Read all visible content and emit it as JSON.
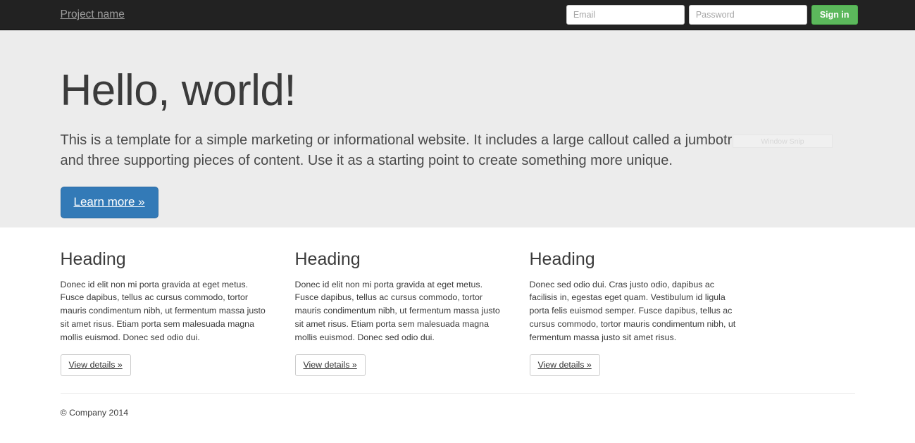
{
  "navbar": {
    "brand": "Project name",
    "email": {
      "placeholder": "Email",
      "value": ""
    },
    "password": {
      "placeholder": "Password",
      "value": ""
    },
    "signin_label": "Sign in",
    "background_color": "#222222",
    "signin_color": "#5cb85c"
  },
  "jumbotron": {
    "title": "Hello, world!",
    "text": "This is a template for a simple marketing or informational website. It includes a large callout called a jumbotron and three supporting pieces of content. Use it as a starting point to create something more unique.",
    "button_label": "Learn more »",
    "background_color": "#ececec",
    "button_color": "#337ab7"
  },
  "overlay": {
    "label": "Window Snip"
  },
  "columns": [
    {
      "heading": "Heading",
      "text": "Donec id elit non mi porta gravida at eget metus. Fusce dapibus, tellus ac cursus commodo, tortor mauris condimentum nibh, ut fermentum massa justo sit amet risus. Etiam porta sem malesuada magna mollis euismod. Donec sed odio dui.",
      "button_label": "View details »"
    },
    {
      "heading": "Heading",
      "text": "Donec id elit non mi porta gravida at eget metus. Fusce dapibus, tellus ac cursus commodo, tortor mauris condimentum nibh, ut fermentum massa justo sit amet risus. Etiam porta sem malesuada magna mollis euismod. Donec sed odio dui.",
      "button_label": "View details »"
    },
    {
      "heading": "Heading",
      "text": "Donec sed odio dui. Cras justo odio, dapibus ac facilisis in, egestas eget quam. Vestibulum id ligula porta felis euismod semper. Fusce dapibus, tellus ac cursus commodo, tortor mauris condimentum nibh, ut fermentum massa justo sit amet risus.",
      "button_label": "View details »"
    }
  ],
  "footer": {
    "copyright": "© Company 2014"
  }
}
